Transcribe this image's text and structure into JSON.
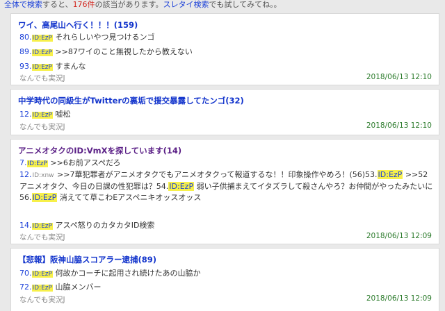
{
  "notice": {
    "part1": "全体で検索",
    "part2": "すると、",
    "count": "176件",
    "part3": "の該当があります。",
    "link": "スレタイ検索",
    "part4": "でも試してみてね。。"
  },
  "threads": [
    {
      "title": "ワイ、高尾山へ行く！！！(159)",
      "posts": [
        {
          "num": "80.",
          "id": "ID:EzP",
          "text": "それらしいやつ見つけるンゴ"
        },
        {
          "num": "89.",
          "id": "ID:EzP",
          "text": ">>87ワイのこと無視したから教えない"
        },
        {
          "num": "93.",
          "id": "ID:EzP",
          "text": "すまんな"
        }
      ],
      "board": "なんでも実況J",
      "date": "2018/06/13 12:10"
    },
    {
      "title": "中学時代の同級生がTwitterの裏垢で援交暴露してたンゴ(32)",
      "posts": [
        {
          "num": "12.",
          "id": "ID:EzP",
          "text": "嘘松"
        }
      ],
      "board": "なんでも実況J",
      "date": "2018/06/13 12:10"
    },
    {
      "title": "アニメオタクのID:VmXを探しています(14)",
      "posts": [
        {
          "num": "7.",
          "id": "ID:EzP",
          "text": ">>6お前アスペだろ"
        },
        {
          "num": "12.",
          "id": "ID:xnw",
          "text_a": ">>7華犯罪者がアニメオタクでもアニメオタクって報道するな！！印象操作やめろ！(56)53.",
          "id_a": "ID:EzP",
          "text_b": ">>52アニメオタク、今日の日課の性犯罪は？54.",
          "id_b": "ID:EzP",
          "text_c": "弱い子供捕まえてイタズラして殺さんやろ？お仲間がやったみたいに56.",
          "id_c": "ID:EzP",
          "text_d": "消えてて草こわEアスペニキオッスオッス"
        },
        {
          "num": "14.",
          "id": "ID:EzP",
          "text": "アスペ怒りのカタカタID検索"
        }
      ],
      "board": "なんでも実況J",
      "date": "2018/06/13 12:09"
    },
    {
      "title": "【悲報】阪神山脇スコアラー逮捕(89)",
      "posts": [
        {
          "num": "70.",
          "id": "ID:EzP",
          "text": "何故かコーチに起用され続けたあの山脇か"
        },
        {
          "num": "72.",
          "id": "ID:EzP",
          "text": "山脇メンバー"
        }
      ],
      "board": "なんでも実況J",
      "date": "2018/06/13 12:09"
    }
  ]
}
